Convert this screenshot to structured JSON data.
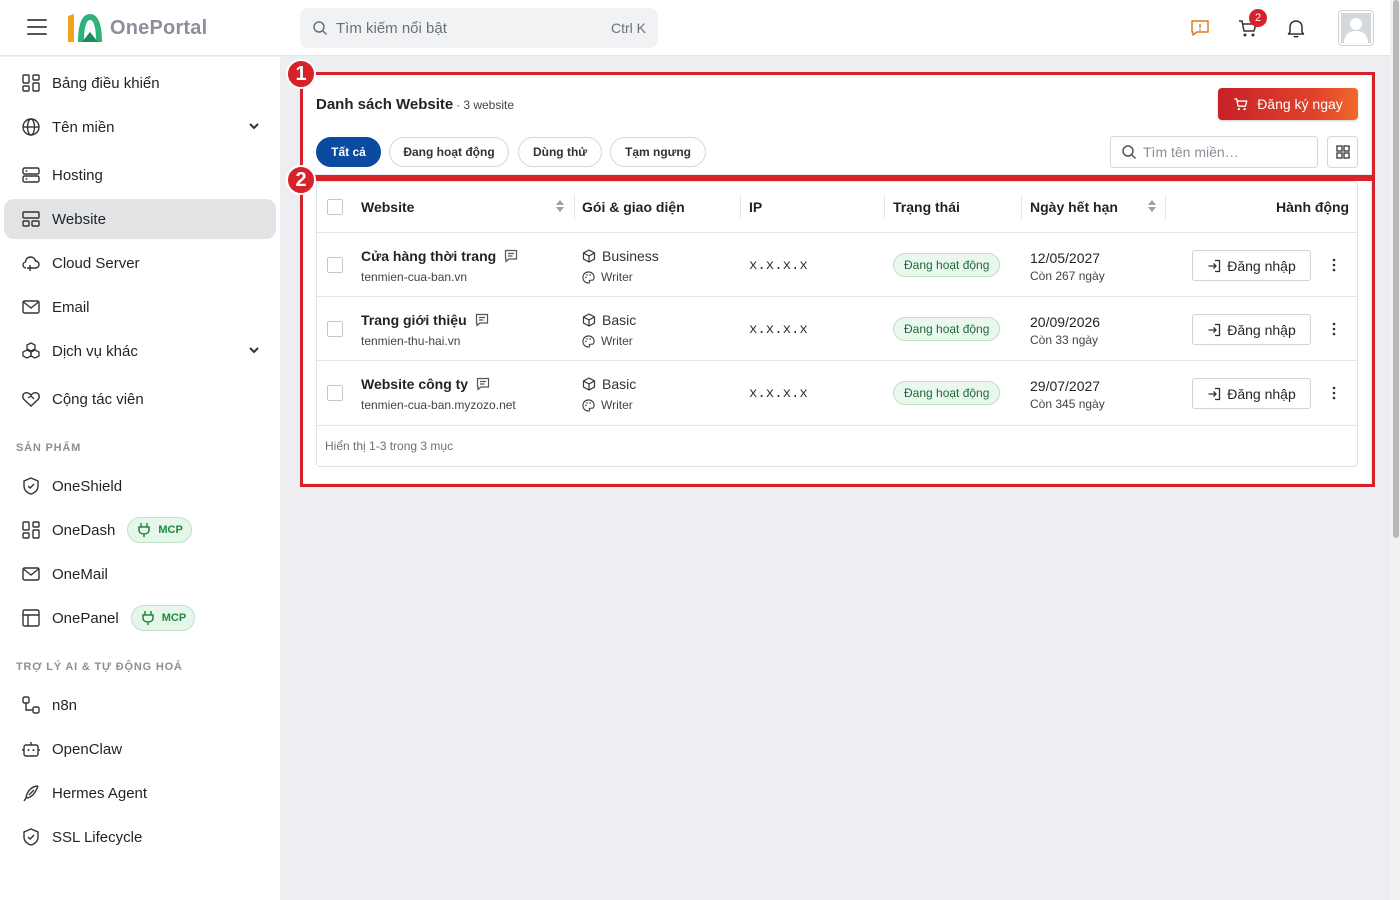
{
  "app": {
    "name": "OnePortal"
  },
  "search": {
    "placeholder": "Tìm kiếm nổi bật",
    "shortcut": "Ctrl K"
  },
  "header": {
    "cart_count": "2"
  },
  "sidebar": {
    "items": [
      {
        "label": "Bảng điều khiển"
      },
      {
        "label": "Tên miền"
      },
      {
        "label": "Hosting"
      },
      {
        "label": "Website"
      },
      {
        "label": "Cloud Server"
      },
      {
        "label": "Email"
      },
      {
        "label": "Dịch vụ khác"
      },
      {
        "label": "Cộng tác viên"
      }
    ],
    "sections": {
      "products": "SẢN PHẨM",
      "ai": "TRỢ LÝ AI & TỰ ĐỘNG HOÁ"
    },
    "products": [
      {
        "label": "OneShield"
      },
      {
        "label": "OneDash",
        "badge": "MCP"
      },
      {
        "label": "OneMail"
      },
      {
        "label": "OnePanel",
        "badge": "MCP"
      }
    ],
    "ai": [
      {
        "label": "n8n"
      },
      {
        "label": "OpenClaw"
      },
      {
        "label": "Hermes Agent"
      },
      {
        "label": "SSL Lifecycle"
      }
    ]
  },
  "callouts": [
    "1",
    "2"
  ],
  "panel": {
    "title": "Danh sách Website",
    "count": "· 3 website",
    "register_button": "Đăng ký ngay",
    "filters": [
      "Tất cả",
      "Đang hoạt động",
      "Dùng thử",
      "Tạm ngưng"
    ],
    "domain_search_placeholder": "Tìm tên miền…"
  },
  "table": {
    "headers": [
      "Website",
      "Gói & giao diện",
      "IP",
      "Trạng thái",
      "Ngày hết hạn",
      "Hành động"
    ],
    "rows": [
      {
        "name": "Cửa hàng thời trang",
        "domain": "tenmien-cua-ban.vn",
        "plan": "Business",
        "theme": "Writer",
        "ip": "x.x.x.x",
        "status": "Đang hoạt động",
        "expiry": "12/05/2027",
        "remaining": "Còn 267 ngày",
        "action": "Đăng nhập"
      },
      {
        "name": "Trang giới thiệu",
        "domain": "tenmien-thu-hai.vn",
        "plan": "Basic",
        "theme": "Writer",
        "ip": "x.x.x.x",
        "status": "Đang hoạt động",
        "expiry": "20/09/2026",
        "remaining": "Còn 33 ngày",
        "action": "Đăng nhập"
      },
      {
        "name": "Website công ty",
        "domain": "tenmien-cua-ban.myzozo.net",
        "plan": "Basic",
        "theme": "Writer",
        "ip": "x.x.x.x",
        "status": "Đang hoạt động",
        "expiry": "29/07/2027",
        "remaining": "Còn 345 ngày",
        "action": "Đăng nhập"
      }
    ],
    "footer": "Hiển thị 1-3 trong 3 mục"
  },
  "colors": {
    "accent": "#0a4aa0",
    "brand_red": "#d6232a",
    "status_green": "#1d6b37"
  },
  "icons": [
    "menu-icon",
    "search-icon",
    "feedback-icon",
    "cart-icon",
    "bell-icon",
    "user-icon"
  ]
}
